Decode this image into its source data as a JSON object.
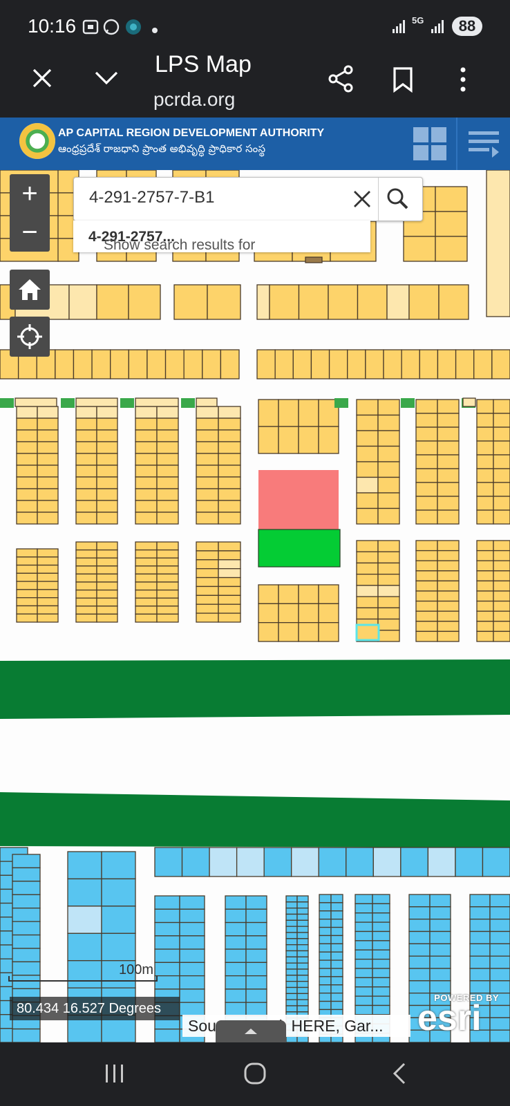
{
  "status_bar": {
    "time": "10:16",
    "network": "5G",
    "battery": "88",
    "icons": [
      "screenshot-icon",
      "whatsapp-icon",
      "app-icon",
      "dot-icon",
      "signal-icon",
      "signal-5g-icon",
      "battery-icon"
    ]
  },
  "browser": {
    "title": "LPS Map",
    "url": "pcrda.org",
    "icons": [
      "close-icon",
      "chevron-down-icon",
      "share-icon",
      "bookmark-icon",
      "more-vert-icon"
    ]
  },
  "header": {
    "title_en": "AP CAPITAL REGION DEVELOPMENT AUTHORITY",
    "title_te": "ఆంధ్రప్రదేశ్ రాజధాని ప్రాంత అభివృద్ధి ప్రాధికార సంస్థ",
    "colors": {
      "bar": "#1d5fa6"
    }
  },
  "map": {
    "zoom_in": "+",
    "zoom_out": "−",
    "search": {
      "value": "4-291-2757-7-B1",
      "suggestion_prefix": "Show search results for ",
      "suggestion_term": "4-291-2757..."
    },
    "scale_label": "100m",
    "coordinates": "80.434 16.527 Degrees",
    "attribution": "Sources: Esri, HERE, Gar...",
    "esri_powered": "POWERED BY",
    "esri_brand": "esri",
    "colors": {
      "plot_residential": "#fdd36a",
      "plot_residential_light": "#fde7ae",
      "plot_blue": "#58c5f0",
      "plot_blue_light": "#bfe4f7",
      "green_band": "#087c33",
      "highlight_red": "#f87b7b",
      "highlight_green": "#04cc34",
      "selected_outline": "#5ce5e8"
    }
  }
}
